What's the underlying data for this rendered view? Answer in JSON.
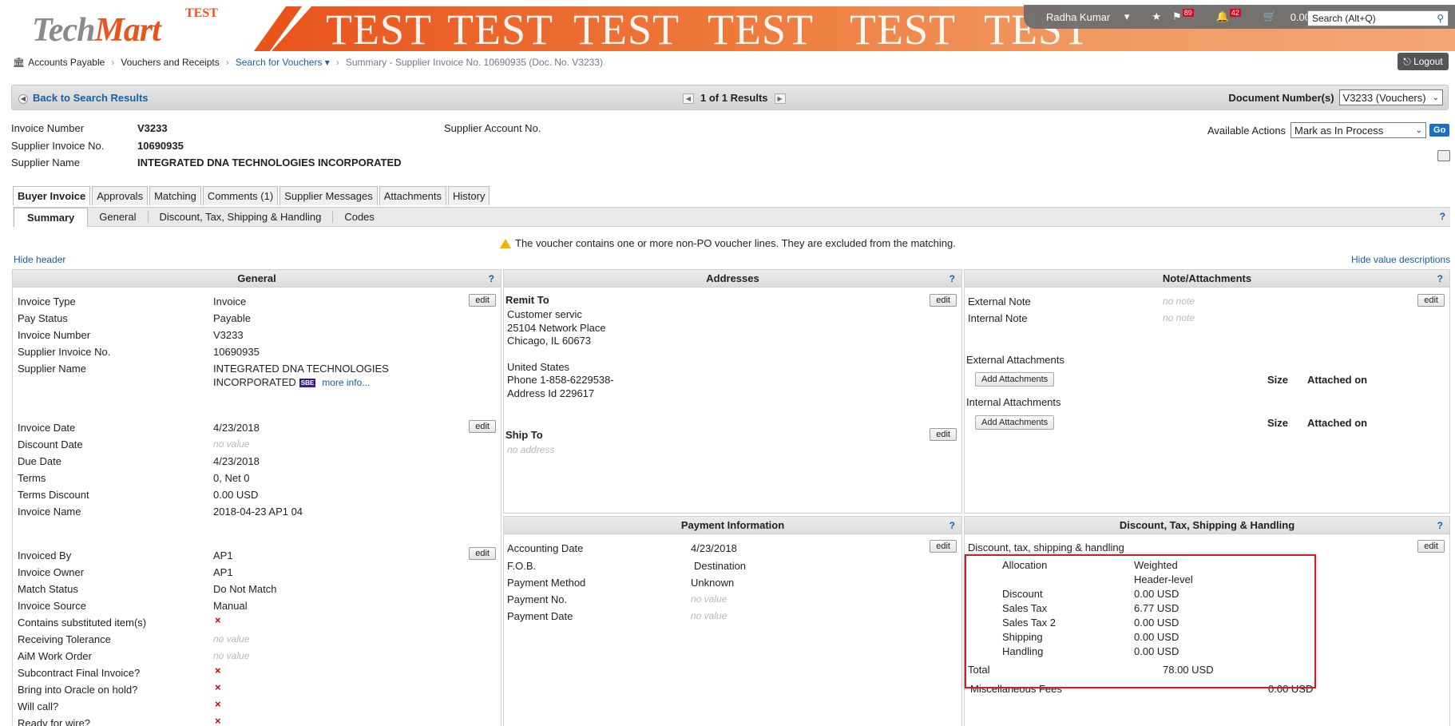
{
  "header": {
    "logo_tech": "Tech",
    "logo_mart": "Mart",
    "logo_test": "TEST",
    "banner_word": "TEST",
    "user": "Radha Kumar",
    "flag_count": "89",
    "bell_count": "42",
    "cart_total": "0.00 USD",
    "search_placeholder": "Search (Alt+Q)"
  },
  "breadcrumb": {
    "items": [
      "Accounts Payable",
      "Vouchers and Receipts",
      "Search for Vouchers",
      "Summary - Supplier Invoice No. 10690935 (Doc. No. V3233)"
    ],
    "logout": "Logout"
  },
  "nav": {
    "back": "Back to Search Results",
    "results": "1 of 1 Results",
    "doc_label": "Document Number(s)",
    "doc_value": "V3233 (Vouchers)"
  },
  "invoice_header": {
    "invoice_number_label": "Invoice Number",
    "invoice_number": "V3233",
    "supplier_invoice_label": "Supplier Invoice No.",
    "supplier_invoice": "10690935",
    "supplier_name_label": "Supplier Name",
    "supplier_name": "INTEGRATED DNA TECHNOLOGIES INCORPORATED",
    "supplier_account_label": "Supplier Account No.",
    "available_actions_label": "Available Actions",
    "available_action": "Mark as In Process",
    "go": "Go"
  },
  "tabs": [
    "Buyer Invoice",
    "Approvals",
    "Matching",
    "Comments (1)",
    "Supplier Messages",
    "Attachments",
    "History"
  ],
  "subtabs": [
    "Summary",
    "General",
    "Discount, Tax, Shipping & Handling",
    "Codes"
  ],
  "warning": "The voucher contains one or more non-PO voucher lines. They are excluded from the matching.",
  "hide_header": "Hide header",
  "hide_value_desc": "Hide value descriptions",
  "general": {
    "title": "General",
    "edit": "edit",
    "invoice_type_label": "Invoice Type",
    "invoice_type": "Invoice",
    "pay_status_label": "Pay Status",
    "pay_status": "Payable",
    "invoice_number_label": "Invoice Number",
    "invoice_number": "V3233",
    "supplier_invoice_label": "Supplier Invoice No.",
    "supplier_invoice": "10690935",
    "supplier_name_label": "Supplier Name",
    "supplier_name_1": "INTEGRATED DNA TECHNOLOGIES",
    "supplier_name_2": "INCORPORATED",
    "sbe": "SBE",
    "more_info": "more info...",
    "invoice_date_label": "Invoice Date",
    "invoice_date": "4/23/2018",
    "discount_date_label": "Discount Date",
    "no_value": "no value",
    "due_date_label": "Due Date",
    "due_date": "4/23/2018",
    "terms_label": "Terms",
    "terms": "0, Net 0",
    "terms_discount_label": "Terms Discount",
    "terms_discount": "0.00 USD",
    "invoice_name_label": "Invoice Name",
    "invoice_name": "2018-04-23 AP1 04",
    "invoiced_by_label": "Invoiced By",
    "invoiced_by": "AP1",
    "invoice_owner_label": "Invoice Owner",
    "invoice_owner": "AP1",
    "match_status_label": "Match Status",
    "match_status": "Do Not Match",
    "invoice_source_label": "Invoice Source",
    "invoice_source": "Manual",
    "substituted_label": "Contains substituted item(s)",
    "receiving_tol_label": "Receiving Tolerance",
    "aim_label": "AiM Work Order",
    "subcontract_label": "Subcontract Final Invoice?",
    "oracle_label": "Bring into Oracle on hold?",
    "will_call_label": "Will call?",
    "wire_label": "Ready for wire?",
    "x_mark": "×"
  },
  "addresses": {
    "title": "Addresses",
    "remit_to": "Remit To",
    "lines": [
      "Customer servic",
      "25104 Network Place",
      "Chicago, IL 60673",
      "United States",
      "Phone 1-858-6229538-",
      "Address Id 229617"
    ],
    "ship_to": "Ship To",
    "no_address": "no address"
  },
  "notes": {
    "title": "Note/Attachments",
    "external_note_label": "External Note",
    "internal_note_label": "Internal Note",
    "no_note": "no note",
    "external_attachments": "External Attachments",
    "internal_attachments": "Internal Attachments",
    "add_attachments": "Add Attachments",
    "size": "Size",
    "attached_on": "Attached on"
  },
  "payment": {
    "title": "Payment Information",
    "accounting_date_label": "Accounting Date",
    "accounting_date": "4/23/2018",
    "fob_label": "F.O.B.",
    "fob": "Destination",
    "method_label": "Payment Method",
    "method": "Unknown",
    "no_label": "Payment No.",
    "date_label": "Payment Date",
    "no_value": "no value"
  },
  "dtsh": {
    "title": "Discount, Tax, Shipping & Handling",
    "subtitle": "Discount, tax, shipping & handling",
    "allocation_label": "Allocation",
    "allocation_1": "Weighted",
    "allocation_2": "Header-level",
    "discount_label": "Discount",
    "discount": "0.00 USD",
    "sales_tax_label": "Sales Tax",
    "sales_tax": "6.77 USD",
    "sales_tax2_label": "Sales Tax 2",
    "sales_tax2": "0.00 USD",
    "shipping_label": "Shipping",
    "shipping": "0.00 USD",
    "handling_label": "Handling",
    "handling": "0.00 USD",
    "total_label": "Total",
    "total": "78.00 USD",
    "misc_label": "Miscellaneous Fees",
    "misc": "0.00 USD"
  },
  "colors": {
    "accent": "#1560a6",
    "brand_orange": "#e8541c",
    "highlight": "#c0252b"
  },
  "help": "?"
}
